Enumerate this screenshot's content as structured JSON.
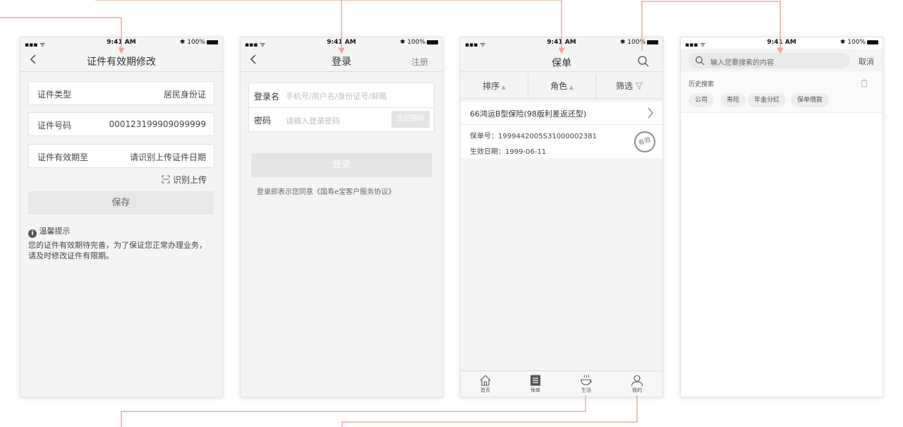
{
  "status": {
    "time": "9:41 AM",
    "battery": "100%",
    "signal": "▪▪▪ ᯤ",
    "bt": "✱"
  },
  "screen1": {
    "title": "证件有效期修改",
    "fields": [
      {
        "label": "证件类型",
        "value": "居民身份证"
      },
      {
        "label": "证件号码",
        "value": "000123199909099999"
      },
      {
        "label": "证件有效期至",
        "value": "请识别上传证件日期"
      }
    ],
    "scan_label": "识别上传",
    "save_label": "保存",
    "tip_title": "温馨提示",
    "tip_text": "您的证件有效期待完善，为了保证您正常办理业务，请及时修改证件有限期。"
  },
  "screen2": {
    "title": "登录",
    "register": "注册",
    "username_label": "登录名",
    "username_placeholder": "手机号/用户名/身份证号/邮箱",
    "password_label": "密码",
    "password_placeholder": "请输入登录密码",
    "forgot_label": "忘记密码",
    "login_label": "登录",
    "agreement": "登录即表示您同意《国寿e宝客户服务协议》"
  },
  "screen3": {
    "title": "保单",
    "filters": [
      {
        "label": "排序"
      },
      {
        "label": "角色"
      },
      {
        "label": "筛选"
      }
    ],
    "policy_name": "66鸿运B型保险(98版利差返还型)",
    "policy_no": "保单号：1999442005S31000002381",
    "effective_date": "生效日期：1999-06-11",
    "stamp": "有效",
    "tabs": [
      "首页",
      "保单",
      "生活",
      "我的"
    ]
  },
  "screen4": {
    "search_placeholder": "输入您要搜索的内容",
    "cancel": "取消",
    "history_title": "历史搜索",
    "history": [
      "公司",
      "寿险",
      "年金分红",
      "保单借款"
    ]
  }
}
